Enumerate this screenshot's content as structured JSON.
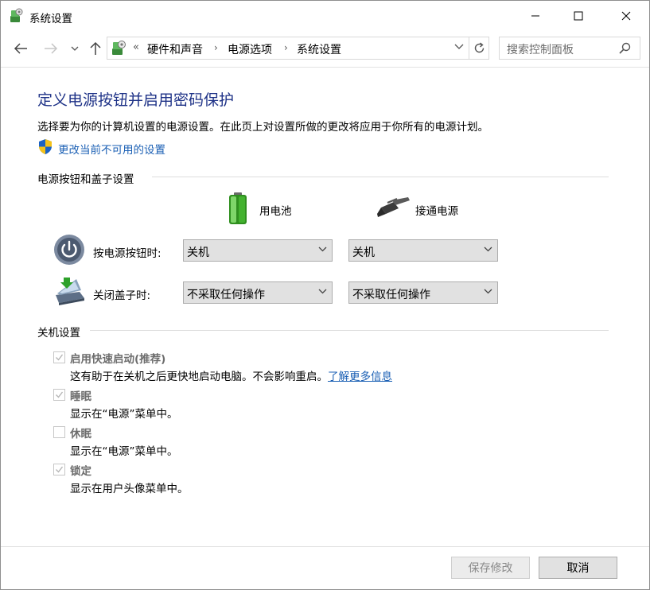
{
  "window": {
    "title": "系统设置"
  },
  "nav": {
    "breadcrumb_prefix": "«",
    "breadcrumbs": [
      "硬件和声音",
      "电源选项",
      "系统设置"
    ],
    "search_placeholder": "搜索控制面板"
  },
  "main": {
    "title": "定义电源按钮并启用密码保护",
    "description": "选择要为你的计算机设置的电源设置。在此页上对设置所做的更改将应用于你所有的电源计划。",
    "change_link": "更改当前不可用的设置"
  },
  "power_section": {
    "heading": "电源按钮和盖子设置",
    "col_battery": "用电池",
    "col_plugged": "接通电源",
    "rows": [
      {
        "label": "按电源按钮时:",
        "battery": "关机",
        "plugged": "关机"
      },
      {
        "label": "关闭盖子时:",
        "battery": "不采取任何操作",
        "plugged": "不采取任何操作"
      }
    ]
  },
  "shutdown_section": {
    "heading": "关机设置",
    "items": [
      {
        "label": "启用快速启动(推荐)",
        "checked": true,
        "desc": "这有助于在关机之后更快地启动电脑。不会影响重启。",
        "link": "了解更多信息"
      },
      {
        "label": "睡眠",
        "checked": true,
        "desc": "显示在“电源”菜单中。"
      },
      {
        "label": "休眠",
        "checked": false,
        "desc": "显示在“电源”菜单中。"
      },
      {
        "label": "锁定",
        "checked": true,
        "desc": "显示在用户头像菜单中。"
      }
    ]
  },
  "footer": {
    "save_label": "保存修改",
    "cancel_label": "取消"
  },
  "colors": {
    "title_blue": "#1e3287",
    "link_blue": "#1a5fb4",
    "disabled_text": "#6d6d6d"
  },
  "icons": [
    "control-panel-icon",
    "minimize-icon",
    "maximize-icon",
    "close-icon",
    "back-arrow-icon",
    "forward-arrow-icon",
    "chevron-down-icon",
    "up-arrow-icon",
    "refresh-icon",
    "search-icon",
    "uac-shield-icon",
    "battery-icon",
    "power-plug-icon",
    "power-button-icon",
    "laptop-lid-icon",
    "checkmark-icon"
  ]
}
